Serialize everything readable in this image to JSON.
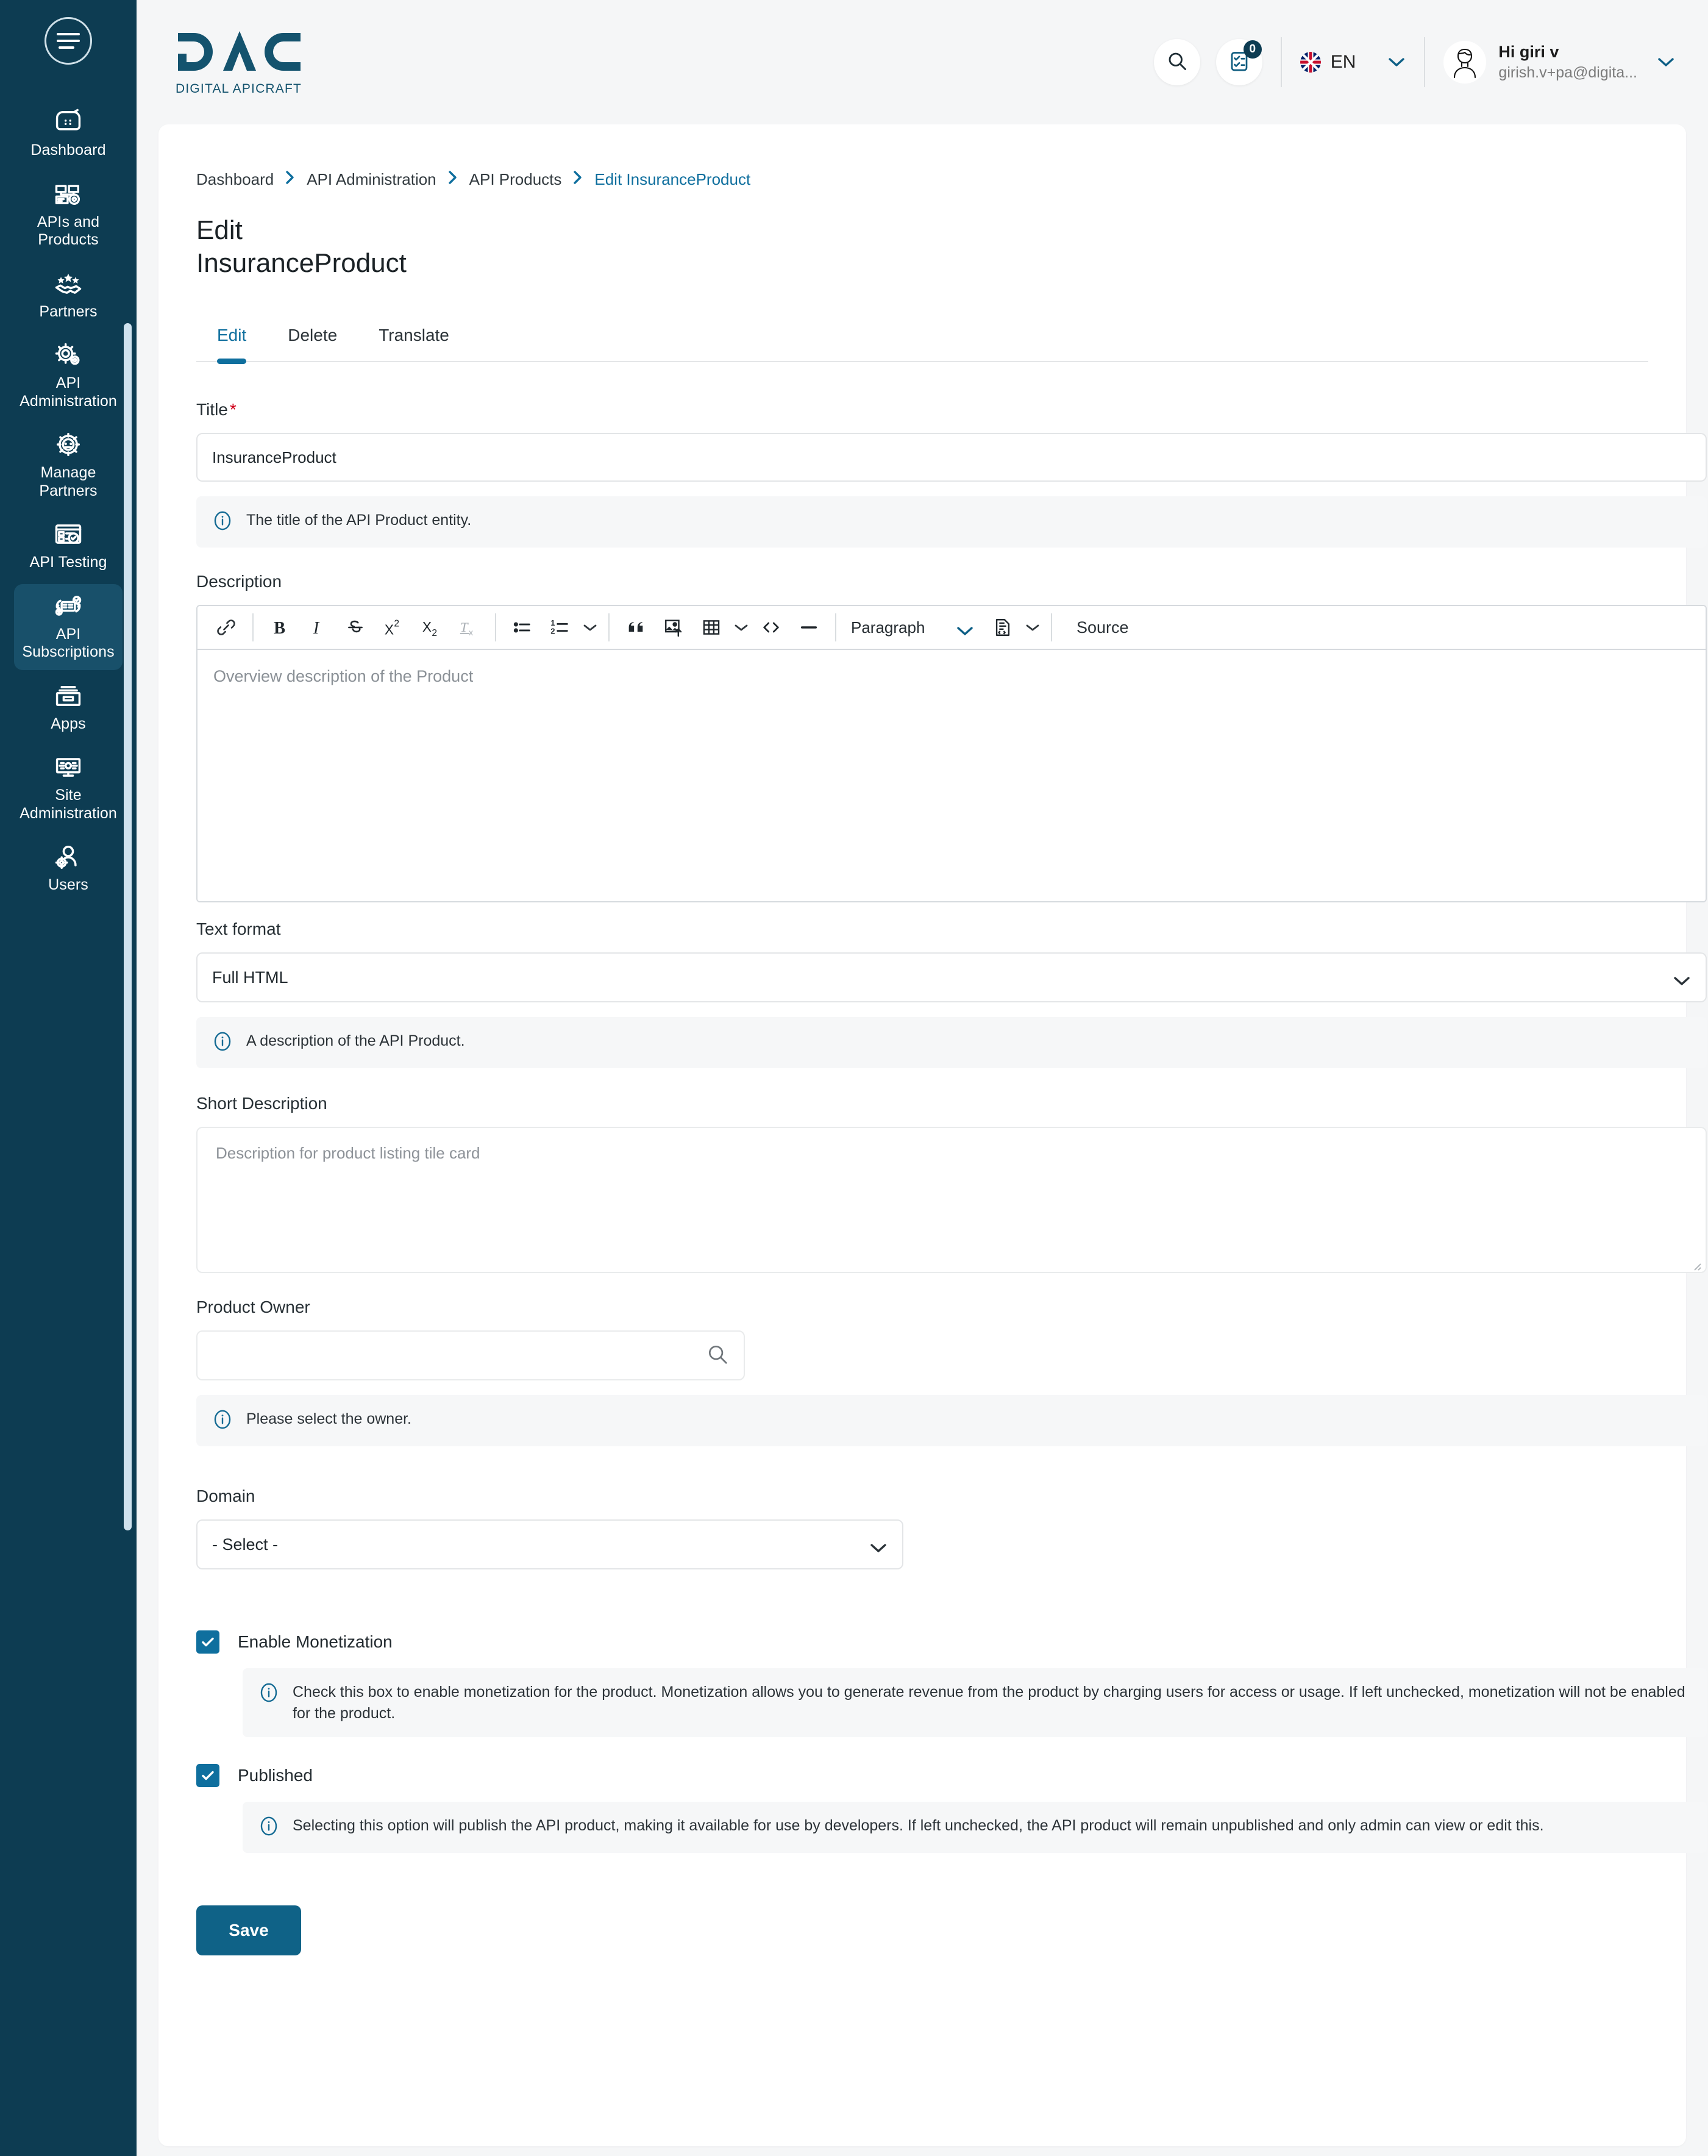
{
  "sidebar": {
    "menu_icon": "hamburger-icon",
    "items": [
      {
        "label": "Dashboard",
        "icon": "dashboard-icon",
        "active": false
      },
      {
        "label": "APIs and\nProducts",
        "icon": "apis-products-icon",
        "active": false
      },
      {
        "label": "Partners",
        "icon": "partners-handshake-icon",
        "active": false
      },
      {
        "label": "API\nAdministration",
        "icon": "api-administration-gear-icon",
        "active": false
      },
      {
        "label": "Manage Partners",
        "icon": "manage-partners-gear-icon",
        "active": false
      },
      {
        "label": "API Testing",
        "icon": "api-testing-icon",
        "active": false
      },
      {
        "label": "API\nSubscriptions",
        "icon": "api-subscriptions-icon",
        "active": true
      },
      {
        "label": "Apps",
        "icon": "apps-box-icon",
        "active": false
      },
      {
        "label": "Site\nAdministration",
        "icon": "site-administration-monitor-icon",
        "active": false
      },
      {
        "label": "Users",
        "icon": "users-gear-icon",
        "active": false
      }
    ]
  },
  "header": {
    "logo_text": "DAC",
    "logo_subtext": "DIGITAL APICRAFT",
    "search_icon": "search-icon",
    "notifications_icon": "tasks-clipboard-icon",
    "notifications_count": "0",
    "language": "EN",
    "language_flag": "uk-flag-icon",
    "user_greeting": "Hi giri v",
    "user_email": "girish.v+pa@digita...",
    "avatar_icon": "user-avatar-icon"
  },
  "breadcrumb": {
    "items": [
      "Dashboard",
      "API Administration",
      "API Products",
      "Edit  InsuranceProduct"
    ]
  },
  "page": {
    "title": "Edit\nInsuranceProduct"
  },
  "tabs": [
    {
      "label": "Edit",
      "active": true
    },
    {
      "label": "Delete",
      "active": false
    },
    {
      "label": "Translate",
      "active": false
    }
  ],
  "form": {
    "title_field": {
      "label": "Title",
      "required_marker": "*",
      "value": "InsuranceProduct",
      "help": "The title of the API Product entity."
    },
    "description_field": {
      "label": "Description",
      "placeholder": "Overview description of the Product",
      "toolbar": {
        "link": "link-icon",
        "bold": "B",
        "italic": "I",
        "strikethrough": "S",
        "superscript": "x²",
        "subscript": "x₂",
        "remove_format": "remove-format-icon",
        "bulleted_list": "bulleted-list-icon",
        "numbered_list": "numbered-list-icon",
        "block_quote": "block-quote-icon",
        "insert_image": "insert-image-icon",
        "insert_table": "insert-table-icon",
        "code": "code-icon",
        "horizontal_line": "horizontal-line-icon",
        "paragraph_style": "Paragraph",
        "templates": "templates-icon",
        "source_label": "Source",
        "source_icon": "source-code-icon"
      }
    },
    "text_format_field": {
      "label": "Text format",
      "value": "Full HTML",
      "help": "A description of the API Product."
    },
    "short_description_field": {
      "label": "Short Description",
      "placeholder": "Description for product listing tile card"
    },
    "product_owner_field": {
      "label": "Product Owner",
      "value": "",
      "search_icon": "search-icon",
      "help": "Please select the owner."
    },
    "domain_field": {
      "label": "Domain",
      "value": "- Select -"
    },
    "monetization_field": {
      "label": "Enable Monetization",
      "checked": true,
      "help": "Check this box to enable monetization for the product. Monetization allows you to generate revenue from the product by charging users for access or usage. If left unchecked, monetization will not be enabled for the product."
    },
    "published_field": {
      "label": "Published",
      "checked": true,
      "help": "Selecting this option will publish the API product, making it available for use by developers. If left unchecked, the API product will remain unpublished and only admin can view or edit this."
    },
    "save_label": "Save"
  },
  "colors": {
    "sidebar_bg": "#0d3c52",
    "accent": "#0f6f9e",
    "button": "#0f6287",
    "required": "#d0021b"
  }
}
